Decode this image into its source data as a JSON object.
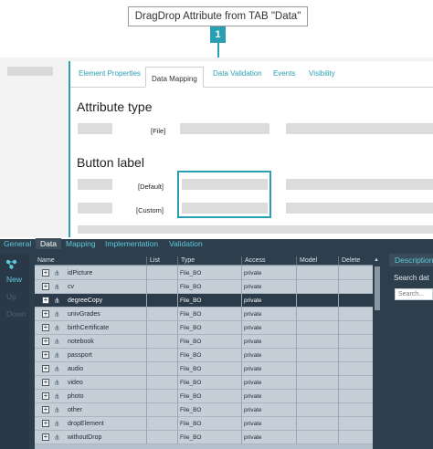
{
  "callout": {
    "text": "DragDrop Attribute from TAB \"Data\"",
    "step": "1",
    "accent": "#2a9fb3"
  },
  "property_tabs": [
    {
      "label": "Element Properties"
    },
    {
      "label": "Data Mapping"
    },
    {
      "label": "Data Validation"
    },
    {
      "label": "Events"
    },
    {
      "label": "Visibility"
    }
  ],
  "attribute_type": {
    "title": "Attribute type",
    "file_label": "[File]"
  },
  "button_label": {
    "title": "Button label",
    "default_label": "[Default]",
    "custom_label": "[Custom]"
  },
  "bottom_tabs": [
    {
      "label": "General"
    },
    {
      "label": "Data"
    },
    {
      "label": "Mapping"
    },
    {
      "label": "Implementation"
    },
    {
      "label": "Validation"
    }
  ],
  "side_nav": {
    "icon": "network-icon",
    "items": [
      "New",
      "Up",
      "Down"
    ]
  },
  "grid": {
    "columns": [
      "Name",
      "List",
      "Type",
      "Access",
      "Model",
      "Delete"
    ],
    "rows": [
      {
        "name": "idPicture",
        "type": "File_BO",
        "access": "private"
      },
      {
        "name": "cv",
        "type": "File_BO",
        "access": "private"
      },
      {
        "name": "degreeCopy",
        "type": "File_BO",
        "access": "private",
        "selected": true
      },
      {
        "name": "univGrades",
        "type": "File_BO",
        "access": "private"
      },
      {
        "name": "birthCertificate",
        "type": "File_BO",
        "access": "private"
      },
      {
        "name": "notebook",
        "type": "File_BO",
        "access": "private"
      },
      {
        "name": "passport",
        "type": "File_BO",
        "access": "private"
      },
      {
        "name": "audio",
        "type": "File_BO",
        "access": "private"
      },
      {
        "name": "video",
        "type": "File_BO",
        "access": "private"
      },
      {
        "name": "photo",
        "type": "File_BO",
        "access": "private"
      },
      {
        "name": "other",
        "type": "File_BO",
        "access": "private"
      },
      {
        "name": "dropElement",
        "type": "File_BO",
        "access": "private"
      },
      {
        "name": "withoutDrop",
        "type": "File_BO",
        "access": "private"
      }
    ]
  },
  "description_panel": {
    "title": "Description",
    "search_label": "Search dat",
    "search_placeholder": "Search..."
  },
  "colors": {
    "accent": "#2a9fb3",
    "dark_panel": "#2d3e4c",
    "tab_text": "#5fc8dc",
    "selected_row": "#2b3b49"
  }
}
